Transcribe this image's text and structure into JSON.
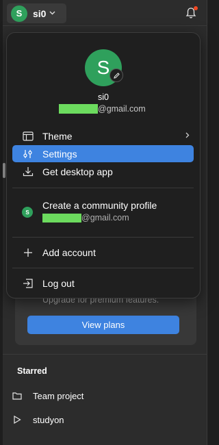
{
  "topbar": {
    "avatar_initial": "S",
    "username": "si0",
    "chevron_icon": "chevron-down-icon",
    "bell_icon": "bell-icon"
  },
  "background": {
    "upgrade_text": "Upgrade for premium features.",
    "view_plans_label": "View plans",
    "starred_title": "Starred",
    "starred_items": [
      {
        "label": "Team project",
        "icon": "folder-icon"
      },
      {
        "label": "studyon",
        "icon": "play-icon"
      }
    ]
  },
  "menu": {
    "avatar_initial": "S",
    "name": "si0",
    "email_suffix": "@gmail.com",
    "items": [
      {
        "label": "Theme",
        "icon": "theme-icon",
        "has_submenu": true
      },
      {
        "label": "Settings",
        "icon": "sliders-icon",
        "active": true
      },
      {
        "label": "Get desktop app",
        "icon": "download-icon"
      }
    ],
    "community": {
      "avatar_initial": "S",
      "title": "Create a community profile",
      "email_suffix": "@gmail.com"
    },
    "add_account_label": "Add account",
    "logout_label": "Log out"
  },
  "colors": {
    "accent": "#3e83e0",
    "avatar_green": "#2fa05c",
    "redaction": "#6cdb5e",
    "notification_dot": "#f24822"
  }
}
